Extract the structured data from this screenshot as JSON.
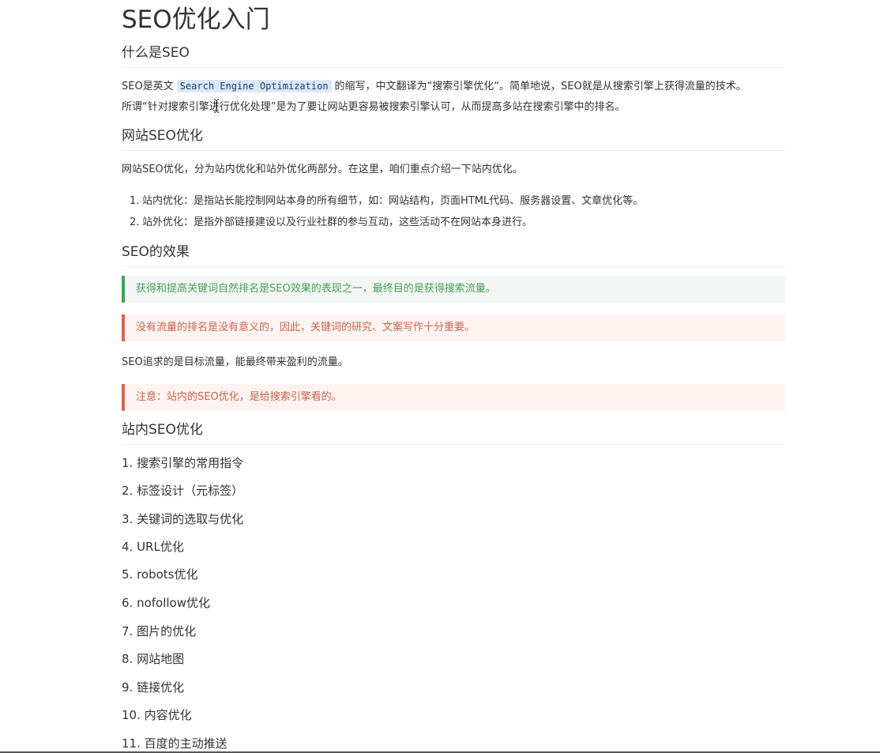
{
  "doc": {
    "title": "SEO优化入门",
    "section1": {
      "heading": "什么是SEO",
      "para_prefix": "SEO是英文",
      "code": "Search Engine Optimization",
      "para_suffix": "的缩写，中文翻译为“搜索引擎优化“。简单地说，SEO就是从搜索引擎上获得流量的技术。",
      "para2": "所谓“针对搜索引擎进行优化处理”是为了要让网站更容易被搜索引擎认可，从而提高多站在搜索引擎中的排名。"
    },
    "section2": {
      "heading": "网站SEO优化",
      "para": "网站SEO优化，分为站内优化和站外优化两部分。在这里，咱们重点介绍一下站内优化。",
      "items": [
        {
          "num": "1.",
          "text": "站内优化：是指站长能控制网站本身的所有细节，如：网站结构，页面HTML代码、服务器设置、文章优化等。"
        },
        {
          "num": "2.",
          "text": "站外优化：是指外部链接建设以及行业社群的参与互动，这些活动不在网站本身进行。"
        }
      ]
    },
    "section3": {
      "heading": "SEO的效果",
      "callout_success": "获得和提高关键词自然排名是SEO效果的表现之一，最终目的是获得搜索流量。",
      "callout_danger": "没有流量的排名是没有意义的，因此，关键词的研究、文案写作十分重要。",
      "para": "SEO追求的是目标流量，能最终带来盈利的流量。",
      "callout_note": "注意：站内的SEO优化，是给搜索引擎看的。"
    },
    "section4": {
      "heading": "站内SEO优化",
      "items": [
        "1. 搜索引擎的常用指令",
        "2. 标签设计（元标签）",
        "3. 关键词的选取与优化",
        "4. URL优化",
        "5. robots优化",
        "6. nofollow优化",
        "7. 图片的优化",
        "8. 网站地图",
        "9. 链接优化",
        "10. 内容优化",
        "11. 百度的主动推送"
      ]
    }
  },
  "colors": {
    "success": "#4a9e5c",
    "danger": "#d36a50",
    "code_bg": "#dce8f7"
  },
  "icons": {
    "cursor": "text-cursor-icon"
  }
}
